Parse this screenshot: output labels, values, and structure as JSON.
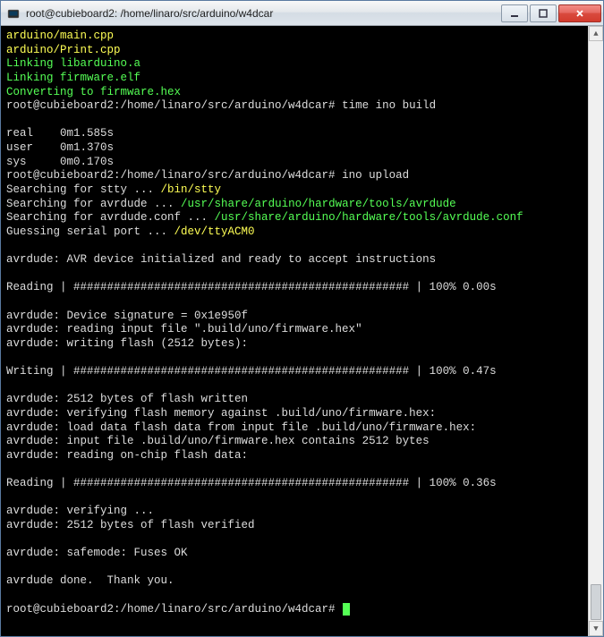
{
  "title": "root@cubieboard2: /home/linaro/src/arduino/w4dcar",
  "lines": [
    {
      "parts": [
        {
          "t": "arduino/main.cpp",
          "c": "yellow"
        }
      ]
    },
    {
      "parts": [
        {
          "t": "arduino/Print.cpp",
          "c": "yellow"
        }
      ]
    },
    {
      "parts": [
        {
          "t": "Linking libarduino.a",
          "c": "green"
        }
      ]
    },
    {
      "parts": [
        {
          "t": "Linking firmware.elf",
          "c": "green"
        }
      ]
    },
    {
      "parts": [
        {
          "t": "Converting to firmware.hex",
          "c": "green"
        }
      ]
    },
    {
      "parts": [
        {
          "t": "root@cubieboard2:/home/linaro/src/arduino/w4dcar# ",
          "c": "white"
        },
        {
          "t": "time ino build",
          "c": "white"
        }
      ]
    },
    {
      "parts": [
        {
          "t": "",
          "c": "white"
        }
      ]
    },
    {
      "parts": [
        {
          "t": "real    0m1.585s",
          "c": "white"
        }
      ]
    },
    {
      "parts": [
        {
          "t": "user    0m1.370s",
          "c": "white"
        }
      ]
    },
    {
      "parts": [
        {
          "t": "sys     0m0.170s",
          "c": "white"
        }
      ]
    },
    {
      "parts": [
        {
          "t": "root@cubieboard2:/home/linaro/src/arduino/w4dcar# ",
          "c": "white"
        },
        {
          "t": "ino upload",
          "c": "white"
        }
      ]
    },
    {
      "parts": [
        {
          "t": "Searching for stty ... ",
          "c": "white"
        },
        {
          "t": "/bin/stty",
          "c": "yellow"
        }
      ]
    },
    {
      "parts": [
        {
          "t": "Searching for avrdude ... ",
          "c": "white"
        },
        {
          "t": "/usr/share/arduino/hardware/tools/avrdude",
          "c": "green"
        }
      ]
    },
    {
      "parts": [
        {
          "t": "Searching for avrdude.conf ... ",
          "c": "white"
        },
        {
          "t": "/usr/share/arduino/hardware/tools/avrdude.conf",
          "c": "green"
        }
      ]
    },
    {
      "parts": [
        {
          "t": "Guessing serial port ... ",
          "c": "white"
        },
        {
          "t": "/dev/ttyACM0",
          "c": "yellow"
        }
      ]
    },
    {
      "parts": [
        {
          "t": "",
          "c": "white"
        }
      ]
    },
    {
      "parts": [
        {
          "t": "avrdude: AVR device initialized and ready to accept instructions",
          "c": "white"
        }
      ]
    },
    {
      "parts": [
        {
          "t": "",
          "c": "white"
        }
      ]
    },
    {
      "parts": [
        {
          "t": "Reading | ################################################## | 100% 0.00s",
          "c": "white"
        }
      ]
    },
    {
      "parts": [
        {
          "t": "",
          "c": "white"
        }
      ]
    },
    {
      "parts": [
        {
          "t": "avrdude: Device signature = 0x1e950f",
          "c": "white"
        }
      ]
    },
    {
      "parts": [
        {
          "t": "avrdude: reading input file \".build/uno/firmware.hex\"",
          "c": "white"
        }
      ]
    },
    {
      "parts": [
        {
          "t": "avrdude: writing flash (2512 bytes):",
          "c": "white"
        }
      ]
    },
    {
      "parts": [
        {
          "t": "",
          "c": "white"
        }
      ]
    },
    {
      "parts": [
        {
          "t": "Writing | ################################################## | 100% 0.47s",
          "c": "white"
        }
      ]
    },
    {
      "parts": [
        {
          "t": "",
          "c": "white"
        }
      ]
    },
    {
      "parts": [
        {
          "t": "avrdude: 2512 bytes of flash written",
          "c": "white"
        }
      ]
    },
    {
      "parts": [
        {
          "t": "avrdude: verifying flash memory against .build/uno/firmware.hex:",
          "c": "white"
        }
      ]
    },
    {
      "parts": [
        {
          "t": "avrdude: load data flash data from input file .build/uno/firmware.hex:",
          "c": "white"
        }
      ]
    },
    {
      "parts": [
        {
          "t": "avrdude: input file .build/uno/firmware.hex contains 2512 bytes",
          "c": "white"
        }
      ]
    },
    {
      "parts": [
        {
          "t": "avrdude: reading on-chip flash data:",
          "c": "white"
        }
      ]
    },
    {
      "parts": [
        {
          "t": "",
          "c": "white"
        }
      ]
    },
    {
      "parts": [
        {
          "t": "Reading | ################################################## | 100% 0.36s",
          "c": "white"
        }
      ]
    },
    {
      "parts": [
        {
          "t": "",
          "c": "white"
        }
      ]
    },
    {
      "parts": [
        {
          "t": "avrdude: verifying ...",
          "c": "white"
        }
      ]
    },
    {
      "parts": [
        {
          "t": "avrdude: 2512 bytes of flash verified",
          "c": "white"
        }
      ]
    },
    {
      "parts": [
        {
          "t": "",
          "c": "white"
        }
      ]
    },
    {
      "parts": [
        {
          "t": "avrdude: safemode: Fuses OK",
          "c": "white"
        }
      ]
    },
    {
      "parts": [
        {
          "t": "",
          "c": "white"
        }
      ]
    },
    {
      "parts": [
        {
          "t": "avrdude done.  Thank you.",
          "c": "white"
        }
      ]
    },
    {
      "parts": [
        {
          "t": "",
          "c": "white"
        }
      ]
    },
    {
      "parts": [
        {
          "t": "root@cubieboard2:/home/linaro/src/arduino/w4dcar# ",
          "c": "white"
        }
      ],
      "cursor": true
    }
  ]
}
